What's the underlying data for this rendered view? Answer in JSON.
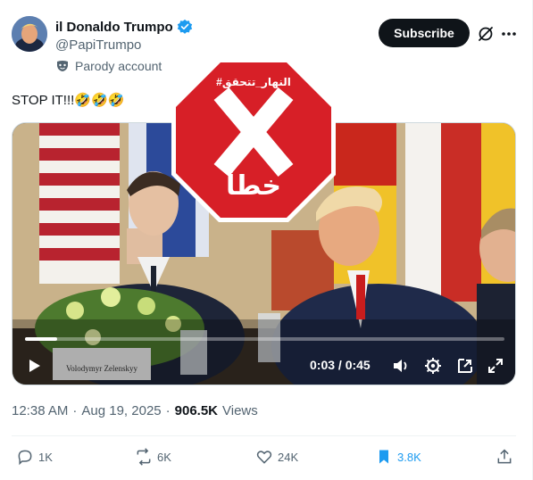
{
  "author": {
    "display_name": "il Donaldo Trumpo",
    "handle": "@PapiTrumpo",
    "label": "Parody account",
    "verified_icon": "verified-badge-icon"
  },
  "header": {
    "subscribe_label": "Subscribe"
  },
  "tweet": {
    "text": "STOP IT!!!🤣🤣🤣"
  },
  "media": {
    "stamp_tag": "#النهار_تتحقق",
    "stamp_mark": "X",
    "stamp_word": "خطأ",
    "stamp_color": "#d71f27",
    "progress_fraction": 0.067,
    "time_display": "0:03 / 0:45",
    "nameplate": "Volodymyr Zelenskyy"
  },
  "meta": {
    "time": "12:38 AM",
    "separator": "·",
    "date": "Aug 19, 2025",
    "separator2": "·",
    "views_count": "906.5K",
    "views_label": "Views"
  },
  "actions": {
    "replies": "1K",
    "reposts": "6K",
    "likes": "24K",
    "bookmarks": "3.8K"
  },
  "colors": {
    "accent": "#1d9bf0",
    "text": "#0f1419",
    "muted": "#536471"
  }
}
